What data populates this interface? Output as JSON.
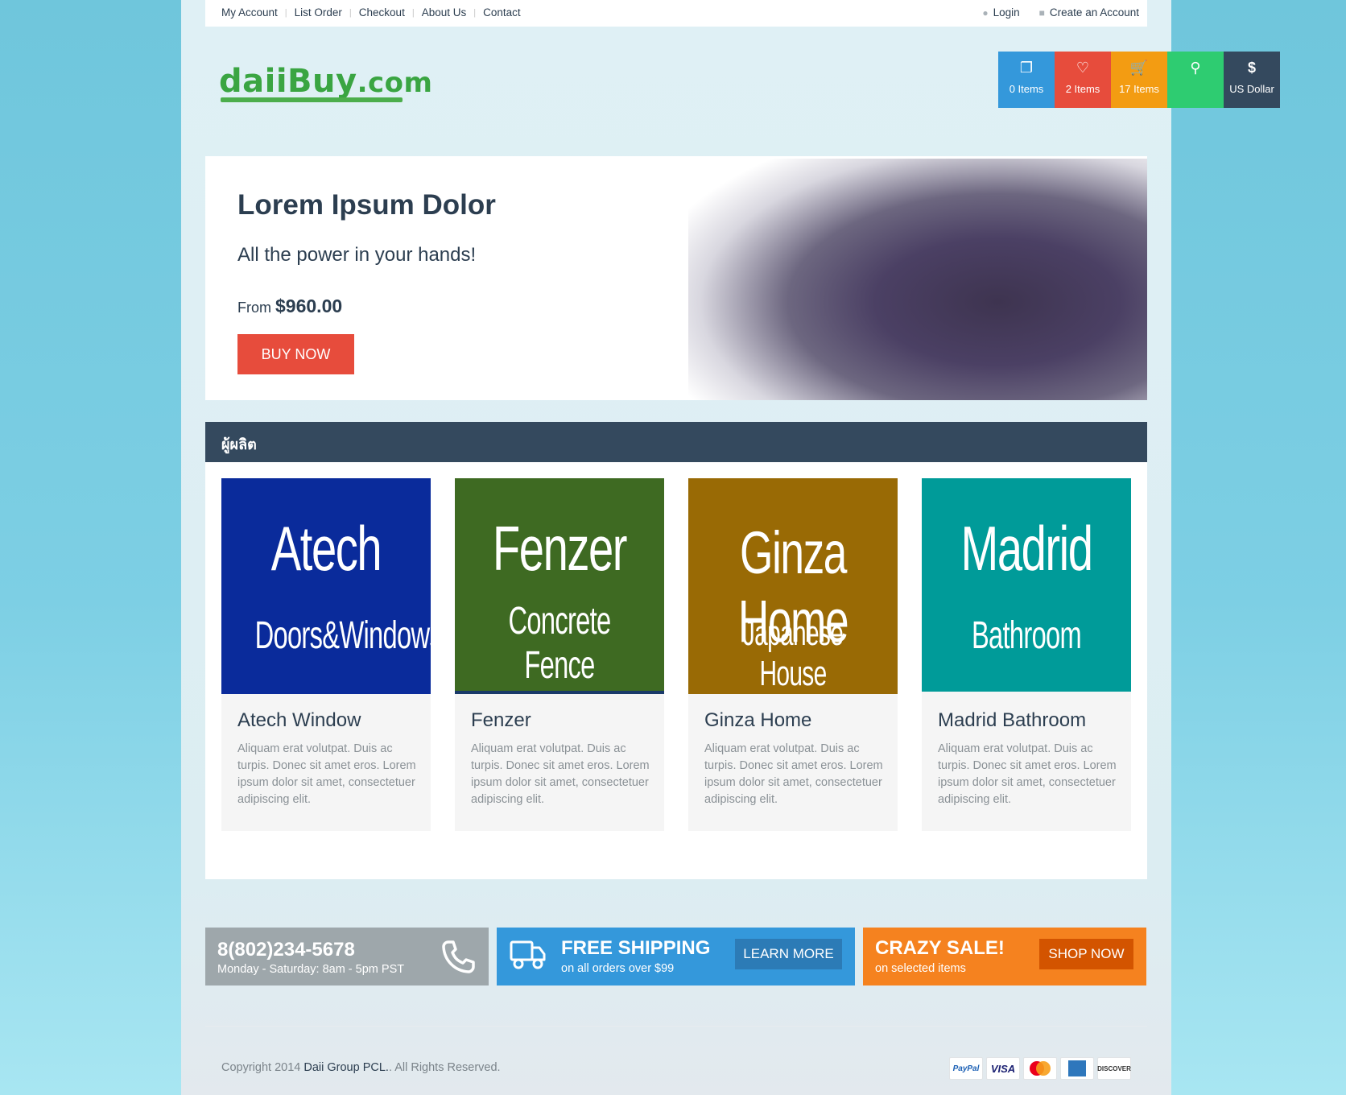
{
  "topbar": {
    "links": [
      "My Account",
      "List Order",
      "Checkout",
      "About Us",
      "Contact"
    ],
    "login": "Login",
    "create_account": "Create an Account"
  },
  "logo": {
    "name": "daiiBuy",
    "tld": ".com"
  },
  "quick": [
    {
      "icon": "compare-icon",
      "label": "0 Items",
      "color": "#3498db"
    },
    {
      "icon": "heart-icon",
      "label": "2 Items",
      "color": "#e74c3c"
    },
    {
      "icon": "cart-icon",
      "label": "17 Items",
      "color": "#f39c12"
    },
    {
      "icon": "map-marker-icon",
      "label": "",
      "color": "#2ecc71"
    },
    {
      "icon": "dollar-icon",
      "label": "US Dollar",
      "color": "#34495e"
    }
  ],
  "hero": {
    "title": "Lorem Ipsum Dolor",
    "subtitle": "All the power in your hands!",
    "price_prefix": "From",
    "price": "$960.00",
    "button": "BUY NOW"
  },
  "section": {
    "title": "ผู้ผลิต"
  },
  "cards": [
    {
      "img_line1": "Atech",
      "img_line2": "Doors&Windows",
      "img_color": "#0a2b9b",
      "title": "Atech Window",
      "desc": "Aliquam erat volutpat. Duis ac turpis. Donec sit amet eros. Lorem ipsum dolor sit amet, consectetuer adipiscing elit."
    },
    {
      "img_line1": "Fenzer",
      "img_line2": "Concrete Fence",
      "img_color": "#3e6a22",
      "title": "Fenzer",
      "desc": "Aliquam erat volutpat. Duis ac turpis. Donec sit amet eros. Lorem ipsum dolor sit amet, consectetuer adipiscing elit."
    },
    {
      "img_line1": "Ginza Home",
      "img_line2": "Japanese House",
      "img_color": "#996a05",
      "title": "Ginza Home",
      "desc": "Aliquam erat volutpat. Duis ac turpis. Donec sit amet eros. Lorem ipsum dolor sit amet, consectetuer adipiscing elit."
    },
    {
      "img_line1": "Madrid",
      "img_line2": "Bathroom",
      "img_color": "#009b99",
      "title": "Madrid Bathroom",
      "desc": "Aliquam erat volutpat. Duis ac turpis. Donec sit amet eros. Lorem ipsum dolor sit amet, consectetuer adipiscing elit."
    }
  ],
  "promos": {
    "phone": {
      "number": "8(802)234-5678",
      "hours": "Monday - Saturday: 8am - 5pm PST",
      "color": "#9ea7ab"
    },
    "shipping": {
      "title": "FREE SHIPPING",
      "sub": "on all orders over $99",
      "button": "LEARN MORE",
      "color": "#3498db"
    },
    "sale": {
      "title": "CRAZY SALE!",
      "sub": "on selected items",
      "button": "SHOP NOW",
      "color": "#f5821f"
    }
  },
  "footer": {
    "copyright_prefix": "Copyright 2014",
    "company": "Daii Group PCL.",
    "copyright_suffix": ". All Rights Reserved.",
    "payments": [
      "PayPal",
      "VISA",
      "MasterCard",
      "American Express",
      "DISCOVER"
    ]
  }
}
